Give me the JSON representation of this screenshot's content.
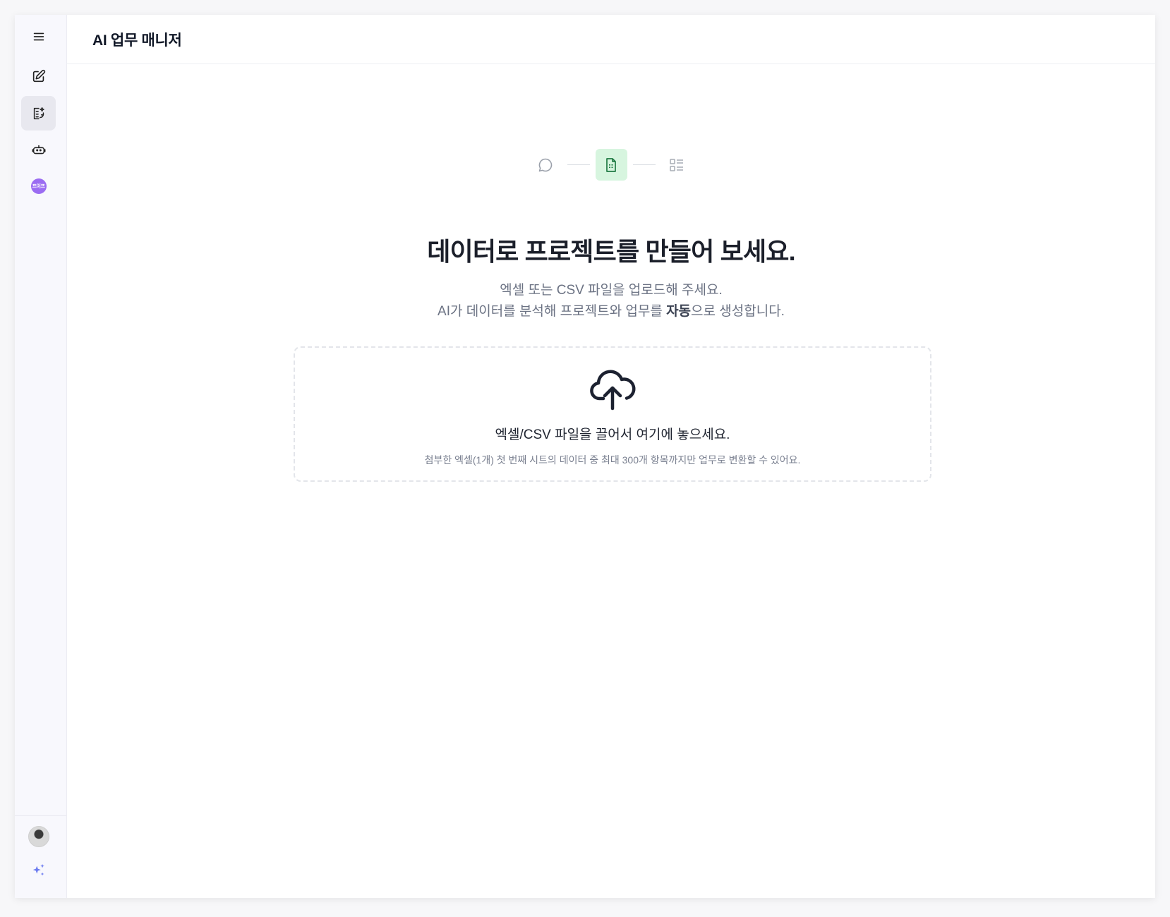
{
  "app": {
    "title": "AI 업무 매니저"
  },
  "sidebar": {
    "items": [
      {
        "name": "menu",
        "icon": "hamburger-icon"
      },
      {
        "name": "new",
        "icon": "edit-icon"
      },
      {
        "name": "data-project",
        "icon": "sparkle-document-icon",
        "active": true
      },
      {
        "name": "bot",
        "icon": "bot-face-icon"
      },
      {
        "name": "workspace",
        "icon": "workspace-avatar",
        "label": "프이프"
      }
    ],
    "bottom": [
      {
        "name": "user-avatar",
        "icon": "user-avatar"
      },
      {
        "name": "ai-sparkle",
        "icon": "sparkles-icon"
      }
    ]
  },
  "steps": [
    {
      "icon": "chat-bubble-icon",
      "active": false
    },
    {
      "icon": "document-sheet-icon",
      "active": true
    },
    {
      "icon": "list-icon",
      "active": false
    }
  ],
  "hero": {
    "headline": "데이터로 프로젝트를 만들어 보세요.",
    "subtitle_line1": "엑셀 또는 CSV 파일을 업로드해 주세요.",
    "subtitle_line2_prefix": "AI가 데이터를 분석해 프로젝트와 업무를 ",
    "subtitle_line2_bold": "자동",
    "subtitle_line2_suffix": "으로 생성합니다."
  },
  "dropzone": {
    "icon": "cloud-upload-icon",
    "title": "엑셀/CSV 파일을 끌어서 여기에 놓으세요.",
    "note": "첨부한 엑셀(1개) 첫 번째 시트의 데이터 중 최대 300개 항목까지만 업무로 변환할 수 있어요."
  },
  "colors": {
    "accent_green_bg": "#d7f5df",
    "accent_green": "#1f7a43",
    "sidebar_bg": "#f8f8fd",
    "workspace_avatar": "#9b6cf2",
    "sparkle": "#6b7bf0"
  }
}
